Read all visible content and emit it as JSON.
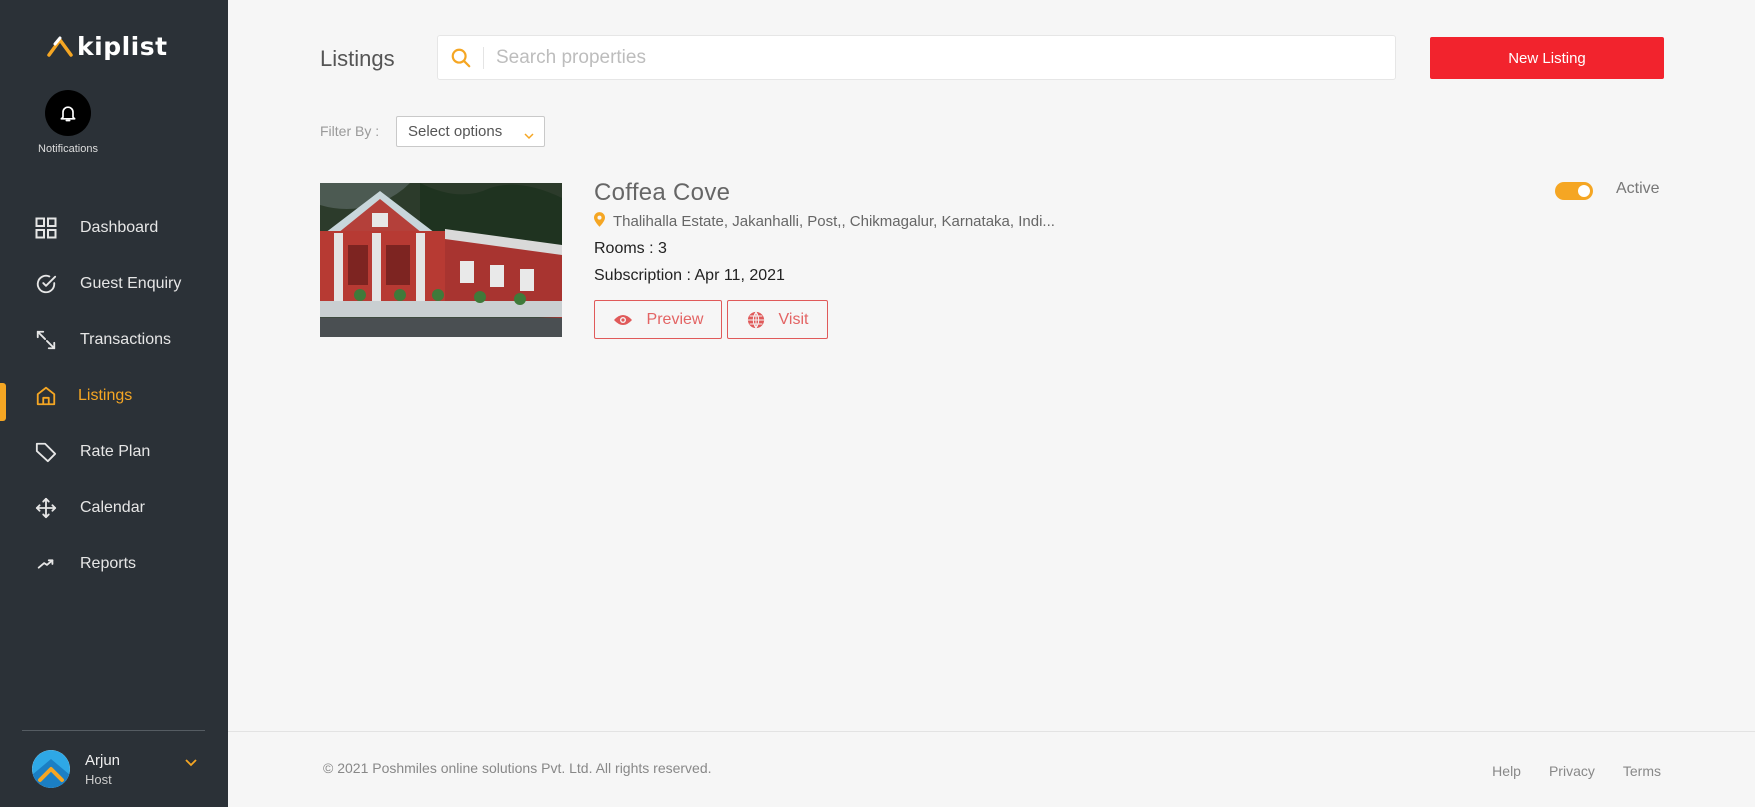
{
  "brand": {
    "name": "kiplist",
    "accent": "#f5a623"
  },
  "notifications": {
    "label": "Notifications",
    "icon": "bell-icon"
  },
  "sidebar": {
    "items": [
      {
        "label": "Dashboard",
        "icon": "grid-icon",
        "active": false
      },
      {
        "label": "Guest Enquiry",
        "icon": "check-circle-icon",
        "active": false
      },
      {
        "label": "Transactions",
        "icon": "arrows-icon",
        "active": false
      },
      {
        "label": "Listings",
        "icon": "home-icon",
        "active": true
      },
      {
        "label": "Rate Plan",
        "icon": "tag-icon",
        "active": false
      },
      {
        "label": "Calendar",
        "icon": "move-icon",
        "active": false
      },
      {
        "label": "Reports",
        "icon": "trend-icon",
        "active": false
      }
    ]
  },
  "user": {
    "name": "Arjun",
    "role": "Host"
  },
  "header": {
    "title": "Listings",
    "search_placeholder": "Search properties",
    "new_button": "New Listing"
  },
  "filter": {
    "label": "Filter By :",
    "selected": "Select options"
  },
  "listing": {
    "name": "Coffea Cove",
    "address": "Thalihalla Estate, Jakanhalli, Post,, Chikmagalur, Karnataka, Indi...",
    "rooms": "Rooms : 3",
    "subscription": "Subscription : Apr 11, 2021",
    "preview_label": "Preview",
    "visit_label": "Visit",
    "status": "Active",
    "active": true
  },
  "footer": {
    "copyright": "© 2021 Poshmiles online solutions Pvt. Ltd. All rights reserved.",
    "links": [
      "Help",
      "Privacy",
      "Terms"
    ]
  },
  "colors": {
    "sidebar_bg": "#2b3137",
    "primary_button": "#f2232d",
    "outline_button": "#e05a5a"
  }
}
